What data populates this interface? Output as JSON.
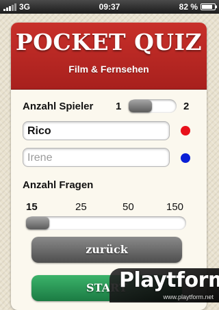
{
  "status_bar": {
    "carrier": "3G",
    "time": "09:37",
    "battery": "82 %",
    "battery_level": 0.82
  },
  "header": {
    "title": "POCKET QUIZ",
    "subtitle": "Film & Fernsehen"
  },
  "players": {
    "label": "Anzahl Spieler",
    "min_label": "1",
    "max_label": "2",
    "selected": 1,
    "fields": [
      {
        "value": "Rico",
        "placeholder": "",
        "color": "#e8101a"
      },
      {
        "value": "",
        "placeholder": "Irene",
        "color": "#0a1fd6"
      }
    ]
  },
  "questions": {
    "label": "Anzahl Fragen",
    "options": [
      "15",
      "25",
      "50",
      "150"
    ],
    "selected": "15"
  },
  "buttons": {
    "back": "zurück",
    "start": "START"
  },
  "watermark": {
    "logo": "Playtform",
    "url": "www.playtform.net"
  }
}
